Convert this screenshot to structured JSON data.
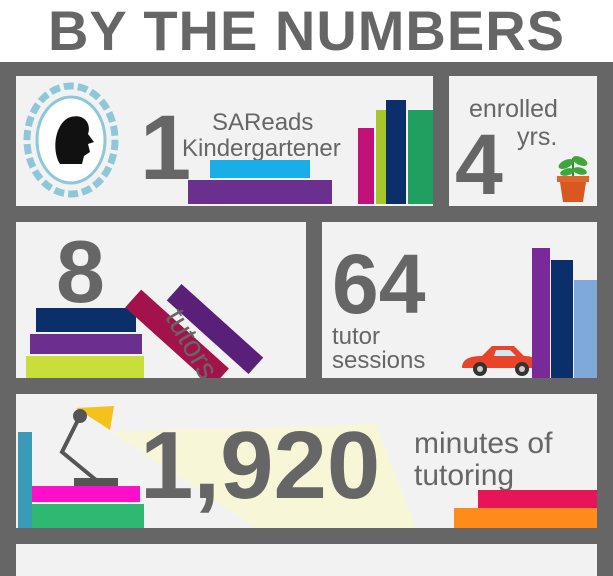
{
  "title": "BY THE NUMBERS",
  "stats": {
    "kindergartener": {
      "number": "1",
      "label_line1": "SAReads",
      "label_line2": "Kindergartener"
    },
    "enrolled": {
      "number": "4",
      "label_top": "enrolled",
      "label_side": "yrs."
    },
    "tutors": {
      "number": "8",
      "label": "tutors"
    },
    "sessions": {
      "number": "64",
      "label_line1": "tutor",
      "label_line2": "sessions"
    },
    "minutes": {
      "number": "1,920",
      "label_line1": "minutes of",
      "label_line2": "tutoring"
    }
  },
  "colors": {
    "shelf": "#666666",
    "cell_background": "#f2f2f2",
    "text": "#666666",
    "frame": "#8ec8d8",
    "magenta": "#c2127a",
    "lime": "#a8c62a",
    "navy": "#0a2f6a",
    "green": "#20a060",
    "sky": "#1aaee8",
    "purple": "#6b2f8f",
    "yellow_green": "#c8de3a",
    "light_blue": "#7fa9d8",
    "red_car": "#e8442a",
    "lamp_yellow": "#f5c21b",
    "pink": "#ff10c8",
    "teal": "#3a9ab8",
    "orange": "#ff8c1a",
    "crimson": "#e8145a"
  },
  "icons": [
    "silhouette-cameo-icon",
    "potted-plant-icon",
    "car-icon",
    "desk-lamp-icon"
  ]
}
